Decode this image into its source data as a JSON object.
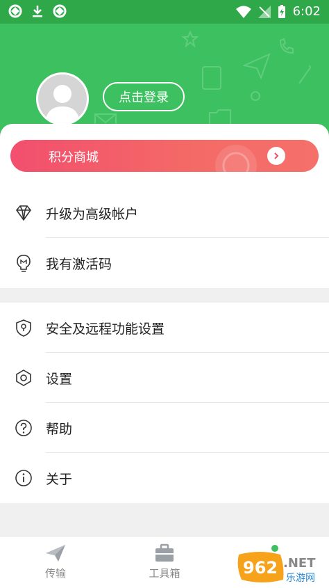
{
  "status_bar": {
    "time": "6:02"
  },
  "profile": {
    "login_label": "点击登录"
  },
  "mall": {
    "label": "积分商城"
  },
  "menu_group1": [
    {
      "label": "升级为高级帐户",
      "icon": "diamond-icon"
    },
    {
      "label": "我有激活码",
      "icon": "lightbulb-icon"
    }
  ],
  "menu_group2": [
    {
      "label": "安全及远程功能设置",
      "icon": "shield-lock-icon"
    },
    {
      "label": "设置",
      "icon": "hexagon-settings-icon"
    },
    {
      "label": "帮助",
      "icon": "question-circle-icon"
    },
    {
      "label": "关于",
      "icon": "info-circle-icon"
    }
  ],
  "tabs": [
    {
      "label": "传输",
      "icon": "send-icon"
    },
    {
      "label": "工具箱",
      "icon": "toolbox-icon"
    }
  ],
  "watermark": {
    "text": "962.NET 乐游网"
  },
  "colors": {
    "header_green": "#3dc160",
    "status_green": "#2fa84a",
    "mall_red": "#f24f6e"
  }
}
